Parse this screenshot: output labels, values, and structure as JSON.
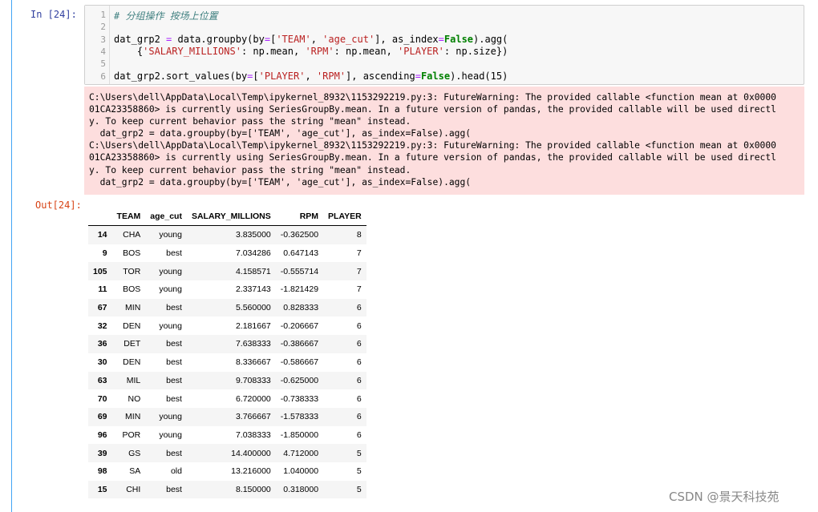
{
  "prompts": {
    "in": "In  [24]:",
    "out": "Out[24]:"
  },
  "code": {
    "line_numbers": [
      "1",
      "2",
      "3",
      "4",
      "5",
      "6"
    ],
    "l1": "# 分组操作 按场上位置",
    "l3a": "dat_grp2 ",
    "l3b": "=",
    "l3c": " data.groupby(by",
    "l3d": "=",
    "l3e": "[",
    "l3f": "'TEAM'",
    "l3g": ", ",
    "l3h": "'age_cut'",
    "l3i": "], as_index",
    "l3j": "=",
    "l3k": "False",
    "l3l": ").agg(",
    "l4a": "    {",
    "l4b": "'SALARY_MILLIONS'",
    "l4c": ": np.mean, ",
    "l4d": "'RPM'",
    "l4e": ": np.mean, ",
    "l4f": "'PLAYER'",
    "l4g": ": np.size})",
    "l6a": "dat_grp2.sort_values(by",
    "l6b": "=",
    "l6c": "[",
    "l6d": "'PLAYER'",
    "l6e": ", ",
    "l6f": "'RPM'",
    "l6g": "], ascending",
    "l6h": "=",
    "l6i": "False",
    "l6j": ").head(15)"
  },
  "stderr_lines": [
    "C:\\Users\\dell\\AppData\\Local\\Temp\\ipykernel_8932\\1153292219.py:3: FutureWarning: The provided callable <function mean at 0x0000",
    "01CA23358860> is currently using SeriesGroupBy.mean. In a future version of pandas, the provided callable will be used directl",
    "y. To keep current behavior pass the string \"mean\" instead.",
    "  dat_grp2 = data.groupby(by=['TEAM', 'age_cut'], as_index=False).agg(",
    "C:\\Users\\dell\\AppData\\Local\\Temp\\ipykernel_8932\\1153292219.py:3: FutureWarning: The provided callable <function mean at 0x0000",
    "01CA23358860> is currently using SeriesGroupBy.mean. In a future version of pandas, the provided callable will be used directl",
    "y. To keep current behavior pass the string \"mean\" instead.",
    "  dat_grp2 = data.groupby(by=['TEAM', 'age_cut'], as_index=False).agg("
  ],
  "table": {
    "columns": [
      "",
      "TEAM",
      "age_cut",
      "SALARY_MILLIONS",
      "RPM",
      "PLAYER"
    ],
    "rows": [
      [
        "14",
        "CHA",
        "young",
        "3.835000",
        "-0.362500",
        "8"
      ],
      [
        "9",
        "BOS",
        "best",
        "7.034286",
        "0.647143",
        "7"
      ],
      [
        "105",
        "TOR",
        "young",
        "4.158571",
        "-0.555714",
        "7"
      ],
      [
        "11",
        "BOS",
        "young",
        "2.337143",
        "-1.821429",
        "7"
      ],
      [
        "67",
        "MIN",
        "best",
        "5.560000",
        "0.828333",
        "6"
      ],
      [
        "32",
        "DEN",
        "young",
        "2.181667",
        "-0.206667",
        "6"
      ],
      [
        "36",
        "DET",
        "best",
        "7.638333",
        "-0.386667",
        "6"
      ],
      [
        "30",
        "DEN",
        "best",
        "8.336667",
        "-0.586667",
        "6"
      ],
      [
        "63",
        "MIL",
        "best",
        "9.708333",
        "-0.625000",
        "6"
      ],
      [
        "70",
        "NO",
        "best",
        "6.720000",
        "-0.738333",
        "6"
      ],
      [
        "69",
        "MIN",
        "young",
        "3.766667",
        "-1.578333",
        "6"
      ],
      [
        "96",
        "POR",
        "young",
        "7.038333",
        "-1.850000",
        "6"
      ],
      [
        "39",
        "GS",
        "best",
        "14.400000",
        "4.712000",
        "5"
      ],
      [
        "98",
        "SA",
        "old",
        "13.216000",
        "1.040000",
        "5"
      ],
      [
        "15",
        "CHI",
        "best",
        "8.150000",
        "0.318000",
        "5"
      ]
    ]
  },
  "watermark": "CSDN @景天科技苑",
  "colors": {
    "stderr_bg": "#fddede",
    "cell_border": "#42a5f5",
    "in_prompt": "#303f9f",
    "out_prompt": "#d84315"
  }
}
